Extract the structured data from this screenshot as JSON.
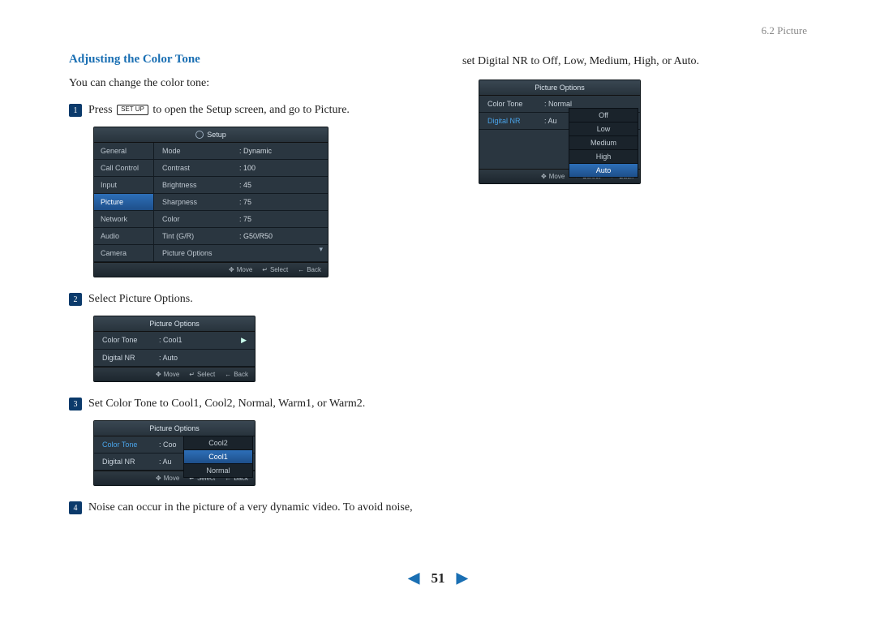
{
  "breadcrumb": "6.2 Picture",
  "heading": "Adjusting the Color Tone",
  "intro": "You can change the color tone:",
  "step1_a": "Press",
  "step1_key": "SET UP",
  "step1_b": "to open the Setup screen, and go to Picture.",
  "osd1": {
    "title": "Setup",
    "side": [
      "General",
      "Call Control",
      "Input",
      "Picture",
      "Network",
      "Audio",
      "Camera"
    ],
    "rows": [
      {
        "lbl": "Mode",
        "val": ": Dynamic"
      },
      {
        "lbl": "Contrast",
        "val": ": 100"
      },
      {
        "lbl": "Brightness",
        "val": ": 45"
      },
      {
        "lbl": "Sharpness",
        "val": ": 75"
      },
      {
        "lbl": "Color",
        "val": ": 75"
      },
      {
        "lbl": "Tint (G/R)",
        "val": ": G50/R50"
      },
      {
        "lbl": "Picture Options",
        "val": ""
      }
    ],
    "foot": {
      "move": "Move",
      "select": "Select",
      "back": "Back"
    }
  },
  "step2": "Select Picture Options.",
  "osd2": {
    "title": "Picture Options",
    "rows": [
      {
        "lbl": "Color Tone",
        "val": ": Cool1"
      },
      {
        "lbl": "Digital NR",
        "val": ": Auto"
      }
    ],
    "foot": {
      "move": "Move",
      "select": "Select",
      "back": "Back"
    }
  },
  "step3": "Set Color Tone to Cool1, Cool2, Normal, Warm1, or Warm2.",
  "osd3": {
    "title": "Picture Options",
    "rows": [
      {
        "lbl": "Color Tone",
        "val": ": Coo"
      },
      {
        "lbl": "Digital NR",
        "val": ": Au"
      }
    ],
    "popup": [
      "Cool2",
      "Cool1",
      "Normal"
    ],
    "foot": {
      "move": "Move",
      "select": "Select",
      "back": "Back"
    }
  },
  "step4": "Noise can occur in the picture of a very dynamic video.  To avoid noise,",
  "right_text": "set Digital NR to Off, Low, Medium, High, or Auto.",
  "osd4": {
    "title": "Picture Options",
    "rows": [
      {
        "lbl": "Color Tone",
        "val": ": Normal"
      },
      {
        "lbl": "Digital NR",
        "val": ": Au"
      }
    ],
    "popup": [
      "Off",
      "Low",
      "Medium",
      "High",
      "Auto"
    ],
    "foot": {
      "move": "Move",
      "select": "Select",
      "back": "Back"
    }
  },
  "page_number": "51"
}
